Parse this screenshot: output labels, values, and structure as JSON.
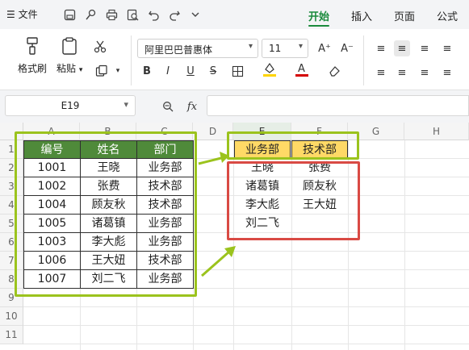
{
  "titlebar": {
    "menu_label": "☰ 文件",
    "tabs": [
      {
        "label": "开始",
        "active": true
      },
      {
        "label": "插入",
        "active": false
      },
      {
        "label": "页面",
        "active": false
      },
      {
        "label": "公式",
        "active": false
      }
    ],
    "quick_icons": [
      "save-icon",
      "format-painter-icon",
      "print-icon",
      "print-preview-icon",
      "undo-icon",
      "redo-icon",
      "chevron-down-icon"
    ]
  },
  "ribbon": {
    "format_painter_label": "格式刷",
    "paste_label": "粘贴",
    "cut_icon": "scissors-icon",
    "copy_icon": "copy-icon",
    "font_name": "阿里巴巴普惠体",
    "font_size": "11",
    "bold": "B",
    "italic": "I",
    "underline": "U",
    "strike": "S",
    "grow_font": "A⁺",
    "shrink_font": "A⁻",
    "font_color": "A",
    "accent_color": "#1a8a3c",
    "font_color_bar": "#d40000",
    "fill_color_bar": "#ffd400"
  },
  "formula_bar": {
    "name_box": "E19",
    "fx_label": "fx",
    "zoom_icon": "magnifier-icon",
    "value": ""
  },
  "sheet": {
    "columns": [
      "A",
      "B",
      "C",
      "D",
      "E",
      "F",
      "G",
      "H"
    ],
    "rows": [
      "1",
      "2",
      "3",
      "4",
      "5",
      "6",
      "7",
      "8",
      "9",
      "10",
      "11"
    ],
    "source_table": {
      "headers": [
        "编号",
        "姓名",
        "部门"
      ],
      "rows": [
        [
          "1001",
          "王晓",
          "业务部"
        ],
        [
          "1002",
          "张费",
          "技术部"
        ],
        [
          "1004",
          "顾友秋",
          "技术部"
        ],
        [
          "1005",
          "诸葛镇",
          "业务部"
        ],
        [
          "1003",
          "李大彪",
          "业务部"
        ],
        [
          "1006",
          "王大妞",
          "技术部"
        ],
        [
          "1007",
          "刘二飞",
          "业务部"
        ]
      ]
    },
    "result_table": {
      "headers": [
        "业务部",
        "技术部"
      ],
      "col_business": [
        "王晓",
        "诸葛镇",
        "李大彪",
        "刘二飞"
      ],
      "col_tech": [
        "张费",
        "顾友秋",
        "王大妞"
      ]
    },
    "header_fill": "#4f8a3a",
    "result_header_fill": "#ffd966",
    "highlight_green": "#9bc31d",
    "highlight_red": "#d94a44"
  }
}
